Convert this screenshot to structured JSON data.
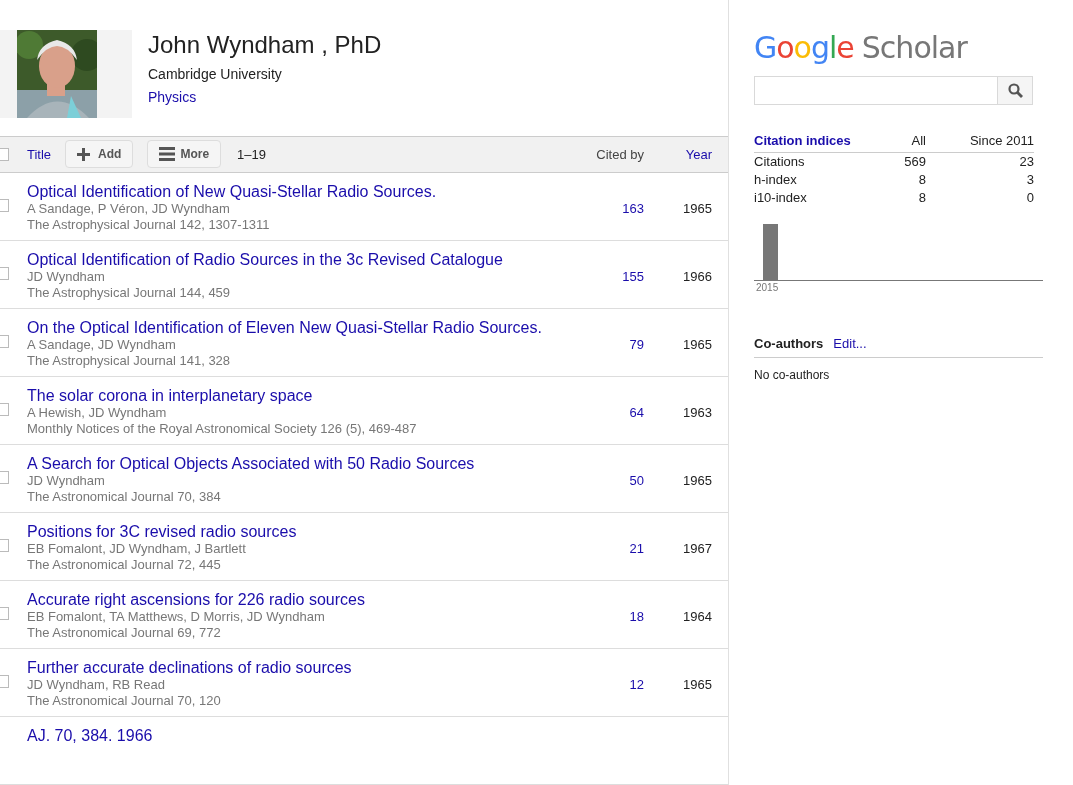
{
  "profile": {
    "name": "John Wyndham , PhD",
    "affiliation": "Cambridge University",
    "field": "Physics"
  },
  "toolbar": {
    "select_all_checked": false,
    "title_sort": "Title",
    "add": "Add",
    "more": "More",
    "range": "1–19",
    "cited_by": "Cited by",
    "year": "Year"
  },
  "articles": [
    {
      "title": "Optical Identification of New Quasi-Stellar Radio Sources.",
      "authors": "A Sandage, P Véron, JD Wyndham",
      "venue": "The Astrophysical Journal 142, 1307-1311",
      "cited_by": "163",
      "year": "1965",
      "checked": false
    },
    {
      "title": "Optical Identification of Radio Sources in the 3c Revised Catalogue",
      "authors": "JD Wyndham",
      "venue": "The Astrophysical Journal 144, 459",
      "cited_by": "155",
      "year": "1966",
      "checked": false
    },
    {
      "title": "On the Optical Identification of Eleven New Quasi-Stellar Radio Sources.",
      "authors": "A Sandage, JD Wyndham",
      "venue": "The Astrophysical Journal 141, 328",
      "cited_by": "79",
      "year": "1965",
      "checked": false
    },
    {
      "title": "The solar corona in interplanetary space",
      "authors": "A Hewish, JD Wyndham",
      "venue": "Monthly Notices of the Royal Astronomical Society 126 (5), 469-487",
      "cited_by": "64",
      "year": "1963",
      "checked": false
    },
    {
      "title": "A Search for Optical Objects Associated with 50 Radio Sources",
      "authors": "JD Wyndham",
      "venue": "The Astronomical Journal 70, 384",
      "cited_by": "50",
      "year": "1965",
      "checked": false
    },
    {
      "title": "Positions for 3C revised radio sources",
      "authors": "EB Fomalont, JD Wyndham, J Bartlett",
      "venue": "The Astronomical Journal 72, 445",
      "cited_by": "21",
      "year": "1967",
      "checked": false
    },
    {
      "title": "Accurate right ascensions for 226 radio sources",
      "authors": "EB Fomalont, TA Matthews, D Morris, JD Wyndham",
      "venue": "The Astronomical Journal 69, 772",
      "cited_by": "18",
      "year": "1964",
      "checked": false
    },
    {
      "title": "Further accurate declinations of radio sources",
      "authors": "JD Wyndham, RB Read",
      "venue": "The Astronomical Journal 70, 120",
      "cited_by": "12",
      "year": "1965",
      "checked": false
    },
    {
      "title": "AJ. 70, 384. 1966"
    }
  ],
  "sidebar": {
    "logo_google": [
      "G",
      "o",
      "o",
      "g",
      "l",
      "e"
    ],
    "logo_scholar": "Scholar",
    "indices": {
      "columns": [
        "Citation indices",
        "All",
        "Since 2011"
      ],
      "rows": [
        [
          "Citations",
          "569",
          "23"
        ],
        [
          "h-index",
          "8",
          "3"
        ],
        [
          "i10-index",
          "8",
          "0"
        ]
      ]
    },
    "chart_year": "2015",
    "coauthors": {
      "heading": "Co-authors",
      "edit": "Edit...",
      "empty": "No co-authors"
    }
  }
}
